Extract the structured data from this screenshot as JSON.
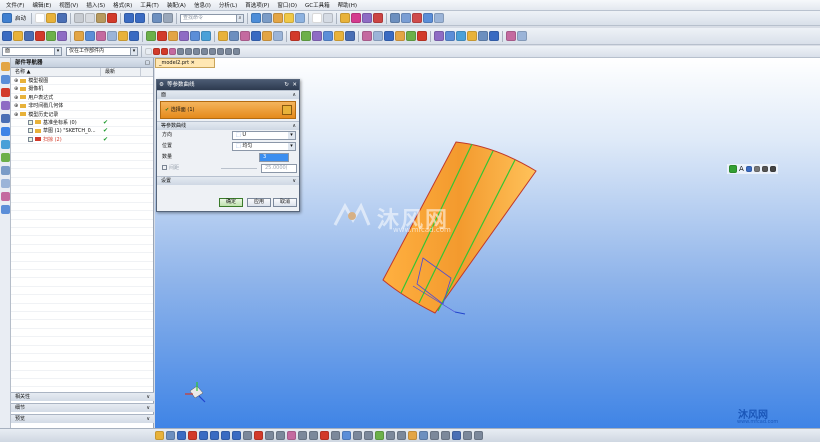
{
  "menu": [
    "文件(F)",
    "编辑(E)",
    "视图(V)",
    "插入(S)",
    "格式(R)",
    "工具(T)",
    "装配(A)",
    "信息(I)",
    "分析(L)",
    "首选项(P)",
    "窗口(O)",
    "GC工具箱",
    "帮助(H)"
  ],
  "toolbar1": {
    "start_label": "启动",
    "search_placeholder": "查找命令"
  },
  "toolbar3": {
    "filter_value": "面",
    "scope_value": "仅在工作部件内"
  },
  "navigator": {
    "title": "部件导航器",
    "col_name": "名称",
    "col_latest": "最新",
    "rows": [
      {
        "label": "模型视图",
        "indent": 1
      },
      {
        "label": "摄像机",
        "indent": 1
      },
      {
        "label": "用户表达式",
        "indent": 1
      },
      {
        "label": "非时间戳几何体",
        "indent": 1
      },
      {
        "label": "模型历史记录",
        "indent": 1
      },
      {
        "label": "基准坐标系 (0)",
        "indent": 2,
        "check": "✔"
      },
      {
        "label": "草图 (1) \"SKETCH_0...",
        "indent": 2,
        "check": "✔"
      },
      {
        "label": "扫掠 (2)",
        "indent": 2,
        "check": "✔",
        "red": true
      }
    ],
    "bottom_sections": [
      "相关性",
      "细节",
      "预览"
    ]
  },
  "graphics_tab": "_model2.prt",
  "dialog": {
    "title": "等参数曲线",
    "section_face": "面",
    "selected_face": "选择面 (1)",
    "section_params": "等参数曲线",
    "dir_label": "方向",
    "dir_value": "U",
    "pos_label": "位置",
    "pos_value": "均匀",
    "count_label": "数量",
    "count_value": "3",
    "spacing_label": "间距",
    "spacing_value": "25.0000(",
    "section_settings": "设置",
    "ok": "确定",
    "apply": "应用",
    "cancel": "取消"
  },
  "watermark": {
    "brand": "沐风网",
    "url": "www.mfcad.com"
  },
  "colors": {
    "surface": "#f39a2e",
    "isoline": "#33c533",
    "background_bottom": "#3f84e6"
  }
}
